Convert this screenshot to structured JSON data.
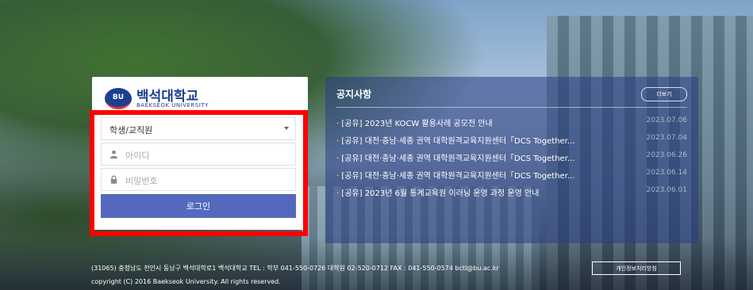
{
  "logo": {
    "name_kr": "백석대학교",
    "name_en": "BAEKSEOK UNIVERSITY",
    "badge": "BU",
    "brand_color": "#1c3f8f"
  },
  "login": {
    "user_type": "학생/교직원",
    "id_placeholder": "아이디",
    "pw_placeholder": "비밀번호",
    "submit_label": "로그인",
    "button_color": "#5469be",
    "highlight_color": "#ff0000"
  },
  "notice": {
    "title": "공지사항",
    "more_label": "더보기",
    "items": [
      {
        "title": "· [공유] 2023년 KOCW 활용사례 공모전 안내",
        "date": "2023.07.06"
      },
      {
        "title": "· [공유] 대전·충남·세종 권역 대학원격교육지원센터「DCS Together...",
        "date": "2023.07.04"
      },
      {
        "title": "· [공유] 대전·충남·세종 권역 대학원격교육지원센터「DCS Together...",
        "date": "2023.06.26"
      },
      {
        "title": "· [공유] 대전·충남·세종 권역 대학원격교육지원센터「DCS Together...",
        "date": "2023.06.14"
      },
      {
        "title": "· [공유] 2023년 6월 통계교육원 이러닝 운영 과정 운영 안내",
        "date": "2023.06.01"
      }
    ]
  },
  "footer": {
    "address": "(31065) 충청남도 천안시 동남구 백석대학로1 백석대학교 TEL : 학부 041-550-0726 대학원 02-520-0712 FAX : 041-550-0574 bctl@bu.ac.kr",
    "copyright": "copyright (C) 2016 Baekseok University. All rights reserved.",
    "privacy_label": "개인정보처리방침"
  }
}
